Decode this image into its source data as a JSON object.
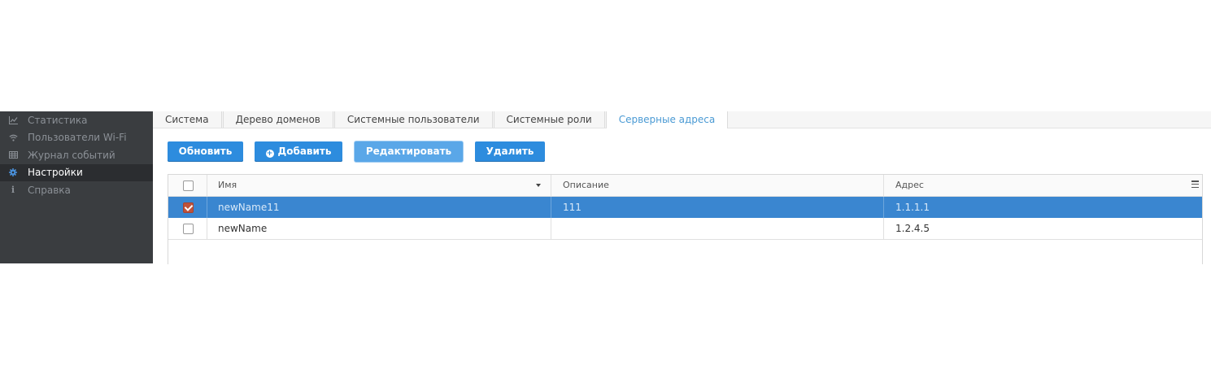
{
  "sidebar": {
    "items": [
      {
        "label": "Статистика",
        "icon": "chart-line-icon",
        "active": false
      },
      {
        "label": "Пользователи Wi-Fi",
        "icon": "wifi-icon",
        "active": false
      },
      {
        "label": "Журнал событий",
        "icon": "table-icon",
        "active": false
      },
      {
        "label": "Настройки",
        "icon": "gear-icon",
        "active": true
      },
      {
        "label": "Справка",
        "icon": "info-icon",
        "active": false
      }
    ]
  },
  "tabs": [
    {
      "label": "Система",
      "active": false
    },
    {
      "label": "Дерево доменов",
      "active": false
    },
    {
      "label": "Системные пользователи",
      "active": false
    },
    {
      "label": "Системные роли",
      "active": false
    },
    {
      "label": "Серверные адреса",
      "active": true
    }
  ],
  "toolbar": {
    "refresh_label": "Обновить",
    "add_label": "Добавить",
    "edit_label": "Редактировать",
    "delete_label": "Удалить"
  },
  "grid": {
    "columns": {
      "name": "Имя",
      "description": "Описание",
      "address": "Адрес"
    },
    "rows": [
      {
        "name": "newName11",
        "description": "111",
        "address": "1.1.1.1",
        "selected": true
      },
      {
        "name": "newName",
        "description": "",
        "address": "1.2.4.5",
        "selected": false
      }
    ]
  },
  "colors": {
    "accent": "#2d8cde",
    "selected_row": "#3a86d0",
    "sidebar_bg": "#3a3d40",
    "checkbox_checked": "#c0523a"
  }
}
